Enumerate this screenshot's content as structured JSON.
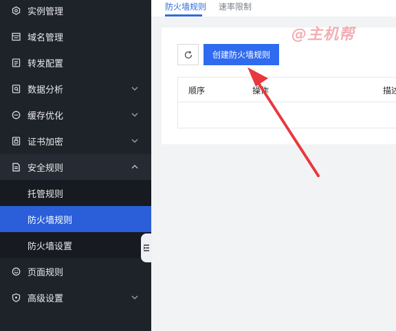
{
  "sidebar": {
    "items": [
      {
        "label": "实例管理",
        "icon": "hexagon-icon"
      },
      {
        "label": "域名管理",
        "icon": "domain-icon"
      },
      {
        "label": "转发配置",
        "icon": "forward-config-icon"
      },
      {
        "label": "数据分析",
        "icon": "analytics-icon"
      },
      {
        "label": "缓存优化",
        "icon": "cache-icon"
      },
      {
        "label": "证书加密",
        "icon": "certificate-icon"
      },
      {
        "label": "安全规则",
        "icon": "security-rule-icon"
      },
      {
        "label": "页面规则",
        "icon": "page-rule-icon"
      },
      {
        "label": "高级设置",
        "icon": "shield-icon"
      }
    ],
    "sub_items": [
      {
        "label": "托管规则"
      },
      {
        "label": "防火墙规则"
      },
      {
        "label": "防火墙设置"
      }
    ]
  },
  "tabs": [
    {
      "label": "防火墙规则"
    },
    {
      "label": "速率限制"
    }
  ],
  "toolbar": {
    "create_label": "创建防火墙规则"
  },
  "table": {
    "columns": [
      "顺序",
      "操作",
      "描述"
    ]
  },
  "watermark": "@主机帮",
  "colors": {
    "sidebar_bg": "#1e2229",
    "active_item": "#2b5fd9",
    "primary": "#2f6bf0",
    "arrow": "#e8383d"
  }
}
